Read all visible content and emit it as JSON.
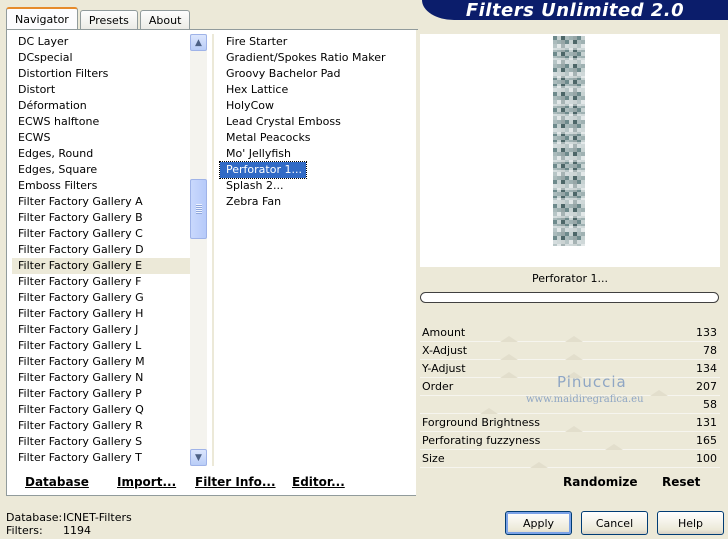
{
  "app": {
    "title": "Filters Unlimited 2.0"
  },
  "tabs": [
    {
      "label": "Navigator",
      "active": true
    },
    {
      "label": "Presets",
      "active": false
    },
    {
      "label": "About",
      "active": false
    }
  ],
  "categories": {
    "items": [
      "DC Layer",
      "DCspecial",
      "Distortion Filters",
      "Distort",
      "Déformation",
      "ECWS halftone",
      "ECWS",
      "Edges, Round",
      "Edges, Square",
      "Emboss Filters",
      "Filter Factory Gallery A",
      "Filter Factory Gallery B",
      "Filter Factory Gallery C",
      "Filter Factory Gallery D",
      "Filter Factory Gallery E",
      "Filter Factory Gallery F",
      "Filter Factory Gallery G",
      "Filter Factory Gallery H",
      "Filter Factory Gallery J",
      "Filter Factory Gallery L",
      "Filter Factory Gallery M",
      "Filter Factory Gallery N",
      "Filter Factory Gallery P",
      "Filter Factory Gallery Q",
      "Filter Factory Gallery R",
      "Filter Factory Gallery S",
      "Filter Factory Gallery T"
    ],
    "selected": "Filter Factory Gallery E"
  },
  "filters": {
    "items": [
      "Fire Starter",
      "Gradient/Spokes Ratio Maker",
      "Groovy Bachelor Pad",
      "Hex Lattice",
      "HolyCow",
      "Lead Crystal Emboss",
      "Metal Peacocks",
      "Mo' Jellyfish",
      "Perforator 1...",
      "Splash 2...",
      "Zebra Fan"
    ],
    "selected": "Perforator 1..."
  },
  "preview": {
    "filter_name": "Perforator 1..."
  },
  "parameters": [
    {
      "label": "Amount",
      "value": "133"
    },
    {
      "label": "X-Adjust",
      "value": "78"
    },
    {
      "label": "Y-Adjust",
      "value": "134"
    },
    {
      "label": "Order",
      "value": "207"
    },
    {
      "label": "",
      "value": "58"
    },
    {
      "label": "Forground Brightness",
      "value": "131"
    },
    {
      "label": "Perforating fuzzyness",
      "value": "165"
    },
    {
      "label": "Size",
      "value": "100"
    }
  ],
  "watermark": {
    "line1": "Pinuccia",
    "line2": "www.maidiregrafica.eu"
  },
  "bottom_links": {
    "database": "Database",
    "import": "Import...",
    "filter_info": "Filter Info...",
    "editor": "Editor..."
  },
  "right_buttons": {
    "randomize": "Randomize",
    "reset": "Reset"
  },
  "status": {
    "database_label": "Database:",
    "database_value": "ICNET-Filters",
    "filters_label": "Filters:",
    "filters_value": "1194"
  },
  "dialog_buttons": {
    "apply": "Apply",
    "cancel": "Cancel",
    "help": "Help"
  },
  "colors": {
    "banner": "#0b1d6b",
    "selection": "#316ac5",
    "face": "#ece9d8"
  }
}
